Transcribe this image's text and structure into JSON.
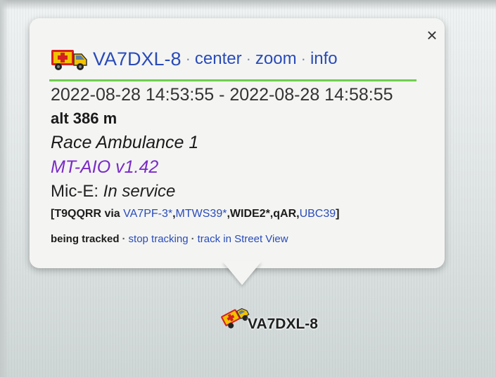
{
  "popup": {
    "close_label": "×",
    "callsign": "VA7DXL-8",
    "links": {
      "center": "center",
      "zoom": "zoom",
      "info": "info"
    },
    "separator": "·",
    "time_range": "2022-08-28 14:53:55 - 2022-08-28 14:58:55",
    "altitude": "alt 386 m",
    "comment": "Race Ambulance 1",
    "device": "MT-AIO v1.42",
    "mice_prefix": "Mic-E:",
    "mice_status": "In service",
    "path": {
      "open": "[",
      "origin": "T9QQRR via",
      "hop1": "VA7PF-3*",
      "comma1": ",",
      "hop2": "MTWS39*",
      "mid": ",WIDE2*,qAR,",
      "igate": "UBC39",
      "close": "]"
    },
    "tracking": {
      "status": "being tracked",
      "stop": "stop tracking",
      "street_view": "track in Street View"
    }
  },
  "marker": {
    "label": "VA7DXL-8",
    "icon": "ambulance-icon"
  },
  "colors": {
    "link": "#2a4bb8",
    "device": "#7a2bc6",
    "rule": "#6fcf4f",
    "ambulance_body": "#f2c200",
    "ambulance_cross": "#d42020"
  }
}
